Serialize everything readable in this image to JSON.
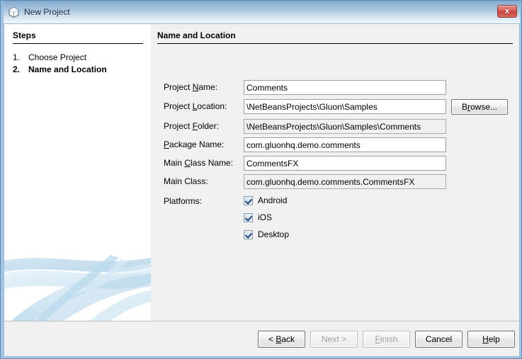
{
  "window": {
    "title": "New Project",
    "icon": "cube-icon",
    "close_label": "x",
    "accent_border": "#96bcde",
    "titlebar_top": "#7da3c8",
    "titlebar_bottom": "#eef4fa"
  },
  "steps_panel": {
    "heading": "Steps",
    "items": [
      {
        "number": "1.",
        "label": "Choose Project",
        "current": false
      },
      {
        "number": "2.",
        "label": "Name and Location",
        "current": true
      }
    ]
  },
  "main_panel": {
    "heading": "Name and Location",
    "fields": [
      {
        "label_pre": "Project ",
        "label_mn": "N",
        "label_post": "ame:",
        "value": "Comments",
        "readonly": false,
        "name": "project-name"
      },
      {
        "label_pre": "Project ",
        "label_mn": "L",
        "label_post": "ocation:",
        "value": "\\NetBeansProjects\\Gluon\\Samples",
        "readonly": false,
        "name": "project-location"
      },
      {
        "label_pre": "Project ",
        "label_mn": "F",
        "label_post": "older:",
        "value": "\\NetBeansProjects\\Gluon\\Samples\\Comments",
        "readonly": true,
        "name": "project-folder"
      },
      {
        "label_pre": "",
        "label_mn": "P",
        "label_post": "ackage Name:",
        "value": "com.gluonhq.demo.comments",
        "readonly": false,
        "name": "package-name"
      },
      {
        "label_pre": "Main ",
        "label_mn": "C",
        "label_post": "lass Name:",
        "value": "CommentsFX",
        "readonly": false,
        "name": "main-class-name"
      },
      {
        "label_pre": "Main Class:",
        "label_mn": "",
        "label_post": "",
        "value": "com.gluonhq.demo.comments.CommentsFX",
        "readonly": true,
        "name": "main-class"
      }
    ],
    "browse_button": {
      "pre": "B",
      "mn": "r",
      "post": "owse..."
    },
    "platforms": {
      "label": "Platforms:",
      "options": [
        {
          "label": "Android",
          "checked": true
        },
        {
          "label": "iOS",
          "checked": true
        },
        {
          "label": "Desktop",
          "checked": true
        }
      ]
    }
  },
  "buttons": [
    {
      "pre": "< ",
      "mn": "B",
      "post": "ack",
      "disabled": false,
      "name": "back-button"
    },
    {
      "pre": "Next >",
      "mn": "",
      "post": "",
      "disabled": true,
      "name": "next-button"
    },
    {
      "pre": "",
      "mn": "F",
      "post": "inish",
      "disabled": true,
      "name": "finish-button"
    },
    {
      "pre": "Cancel",
      "mn": "",
      "post": "",
      "disabled": false,
      "name": "cancel-button"
    },
    {
      "pre": "",
      "mn": "H",
      "post": "elp",
      "disabled": false,
      "name": "help-button"
    }
  ]
}
